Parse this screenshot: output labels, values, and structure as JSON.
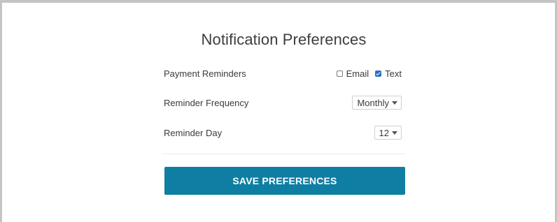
{
  "title": "Notification Preferences",
  "payment_reminders": {
    "label": "Payment Reminders",
    "email": {
      "label": "Email",
      "checked": false
    },
    "text": {
      "label": "Text",
      "checked": true
    }
  },
  "reminder_frequency": {
    "label": "Reminder Frequency",
    "selected": "Monthly"
  },
  "reminder_day": {
    "label": "Reminder Day",
    "selected": "12"
  },
  "save_button": {
    "label": "SAVE PREFERENCES"
  },
  "colors": {
    "button": "#0f7ea3",
    "checkbox_checked": "#2a6fc4"
  }
}
